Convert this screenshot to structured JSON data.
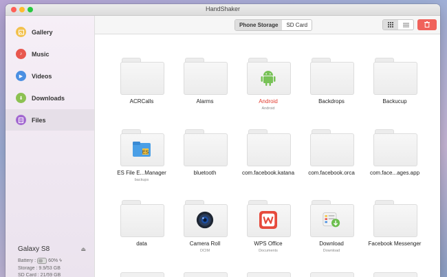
{
  "window": {
    "title": "HandShaker"
  },
  "sidebar": {
    "items": [
      {
        "label": "Gallery",
        "icon": "gallery-icon",
        "color": "#f2c14e"
      },
      {
        "label": "Music",
        "icon": "music-icon",
        "color": "#e8574e"
      },
      {
        "label": "Videos",
        "icon": "video-icon",
        "color": "#4a8fe2"
      },
      {
        "label": "Downloads",
        "icon": "download-icon",
        "color": "#8cc152"
      },
      {
        "label": "Files",
        "icon": "files-icon",
        "color": "#a46ad1",
        "active": true
      }
    ]
  },
  "device": {
    "name": "Galaxy S8",
    "battery_label": "Battery :",
    "battery_percent": "60%",
    "battery_level": 0.6,
    "storage_label": "Storage : 9.9/53 GB",
    "sd_card_label": "SD Card : 21/59 GB"
  },
  "toolbar": {
    "storage_tabs": [
      {
        "label": "Phone Storage",
        "selected": true
      },
      {
        "label": "SD Card",
        "selected": false
      }
    ],
    "view_modes": [
      "grid-view-icon",
      "list-view-icon"
    ],
    "delete_icon": "trash-icon"
  },
  "files": [
    {
      "name": "ACRCalls",
      "sub": ""
    },
    {
      "name": "Alarms",
      "sub": ""
    },
    {
      "name": "Android",
      "sub": "Android",
      "selected": true,
      "emblem": "android-icon"
    },
    {
      "name": "Backdrops",
      "sub": ""
    },
    {
      "name": "Backucup",
      "sub": ""
    },
    {
      "name": "ES File E...Manager",
      "sub": "backups",
      "emblem": "es-file-explorer-icon"
    },
    {
      "name": "bluetooth",
      "sub": ""
    },
    {
      "name": "com.facebook.katana",
      "sub": ""
    },
    {
      "name": "com.facebook.orca",
      "sub": ""
    },
    {
      "name": "com.face...ages.app",
      "sub": ""
    },
    {
      "name": "data",
      "sub": ""
    },
    {
      "name": "Camera Roll",
      "sub": "DCIM",
      "emblem": "camera-lens-icon"
    },
    {
      "name": "WPS Office",
      "sub": "Documents",
      "emblem": "wps-office-icon"
    },
    {
      "name": "Download",
      "sub": "Download",
      "emblem": "download-box-icon"
    },
    {
      "name": "Facebook Messenger",
      "sub": ""
    }
  ],
  "colors": {
    "selected_text": "#e23b2e",
    "delete_button": "#f0625b"
  }
}
